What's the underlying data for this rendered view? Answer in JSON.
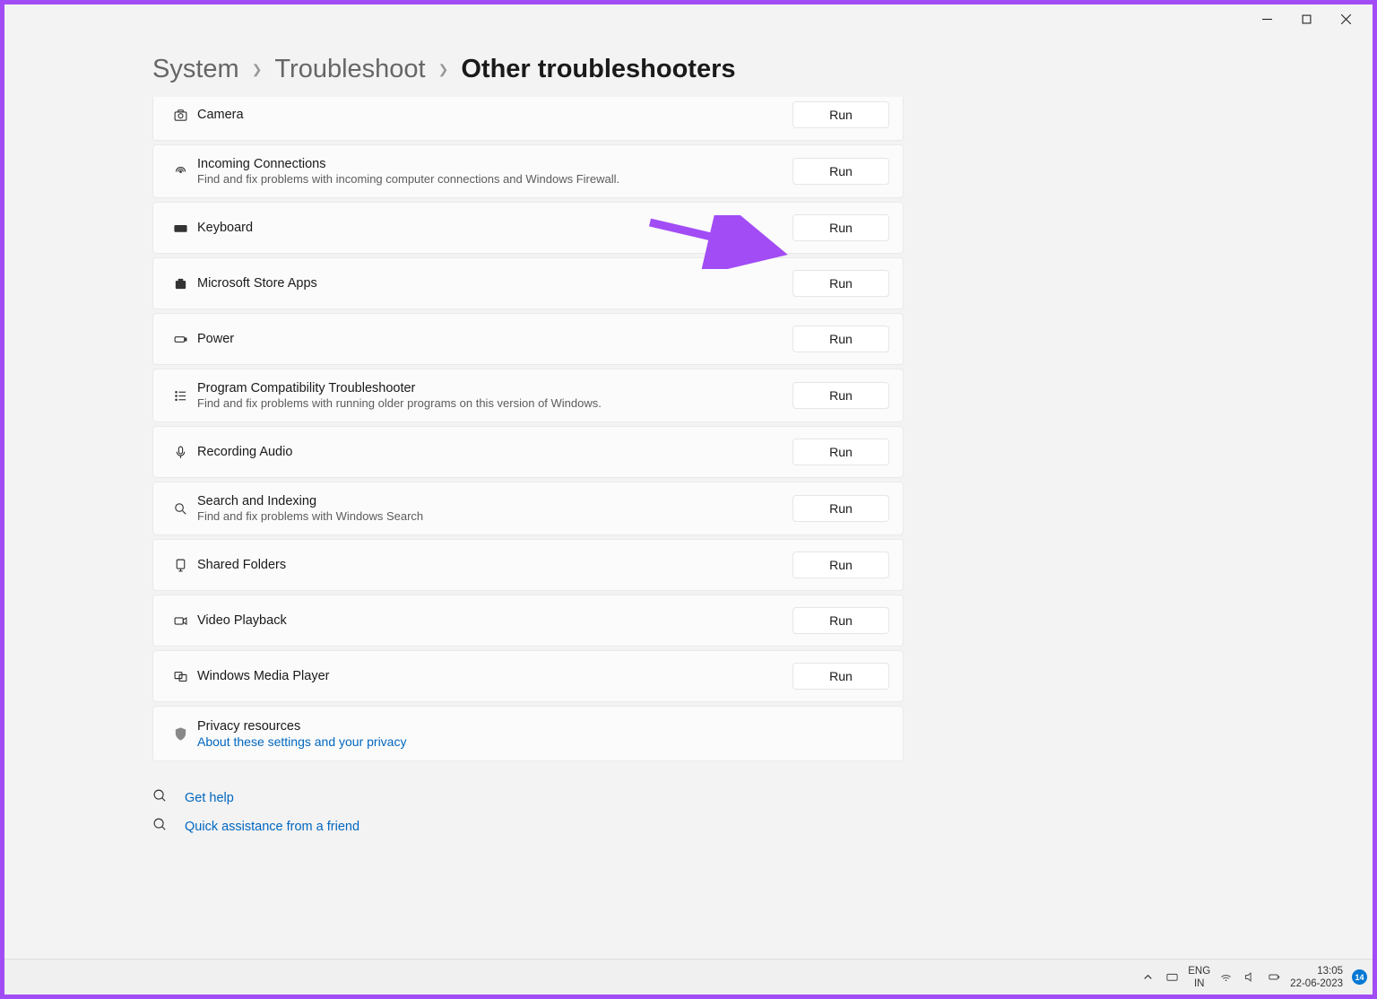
{
  "breadcrumb": {
    "root": "System",
    "mid": "Troubleshoot",
    "current": "Other troubleshooters"
  },
  "run_label": "Run",
  "items": [
    {
      "title": "Camera",
      "desc": ""
    },
    {
      "title": "Incoming Connections",
      "desc": "Find and fix problems with incoming computer connections and Windows Firewall."
    },
    {
      "title": "Keyboard",
      "desc": ""
    },
    {
      "title": "Microsoft Store Apps",
      "desc": ""
    },
    {
      "title": "Power",
      "desc": ""
    },
    {
      "title": "Program Compatibility Troubleshooter",
      "desc": "Find and fix problems with running older programs on this version of Windows."
    },
    {
      "title": "Recording Audio",
      "desc": ""
    },
    {
      "title": "Search and Indexing",
      "desc": "Find and fix problems with Windows Search"
    },
    {
      "title": "Shared Folders",
      "desc": ""
    },
    {
      "title": "Video Playback",
      "desc": ""
    },
    {
      "title": "Windows Media Player",
      "desc": ""
    }
  ],
  "privacy": {
    "title": "Privacy resources",
    "link": "About these settings and your privacy"
  },
  "help": {
    "get_help": "Get help",
    "quick_assist": "Quick assistance from a friend"
  },
  "taskbar": {
    "lang1": "ENG",
    "lang2": "IN",
    "time": "13:05",
    "date": "22-06-2023",
    "badge": "14"
  }
}
